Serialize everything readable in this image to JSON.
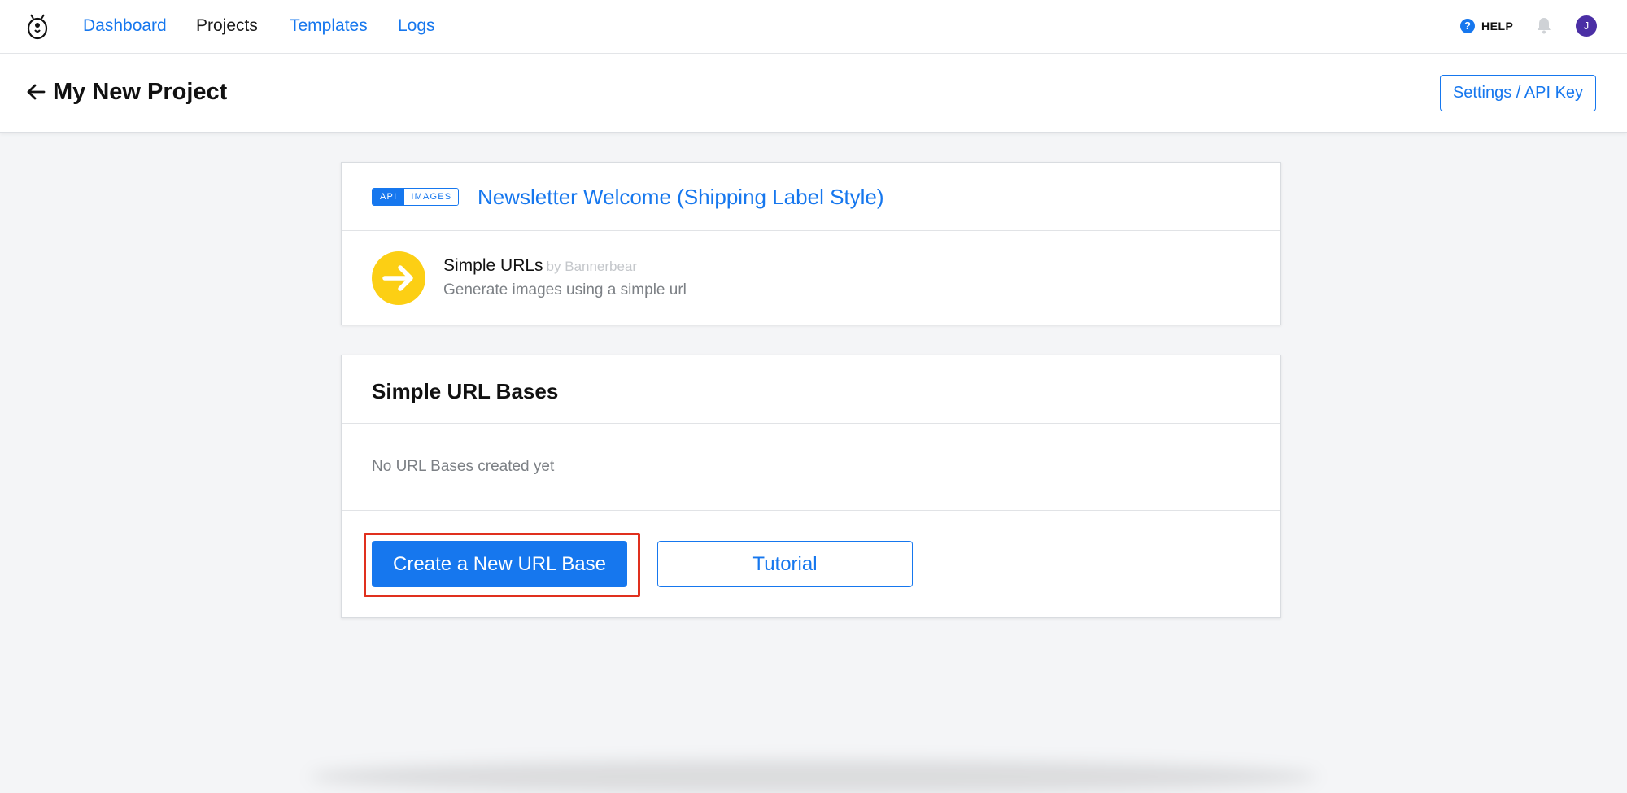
{
  "nav": {
    "links": [
      {
        "label": "Dashboard"
      },
      {
        "label": "Projects"
      },
      {
        "label": "Templates"
      },
      {
        "label": "Logs"
      }
    ],
    "help_label": "HELP",
    "avatar_initial": "J"
  },
  "header": {
    "title": "My New Project",
    "settings_label": "Settings / API Key"
  },
  "template_card": {
    "badge_primary": "API",
    "badge_secondary": "IMAGES",
    "title": "Newsletter Welcome (Shipping Label Style)",
    "integration": {
      "name": "Simple URLs",
      "by": "by Bannerbear",
      "description": "Generate images using a simple url"
    }
  },
  "url_bases": {
    "title": "Simple URL Bases",
    "empty_text": "No URL Bases created yet",
    "create_label": "Create a New URL Base",
    "tutorial_label": "Tutorial"
  },
  "colors": {
    "accent": "#1677ee",
    "integration_icon": "#fccf14",
    "avatar": "#4b2fa5",
    "highlight": "#e0301e"
  }
}
